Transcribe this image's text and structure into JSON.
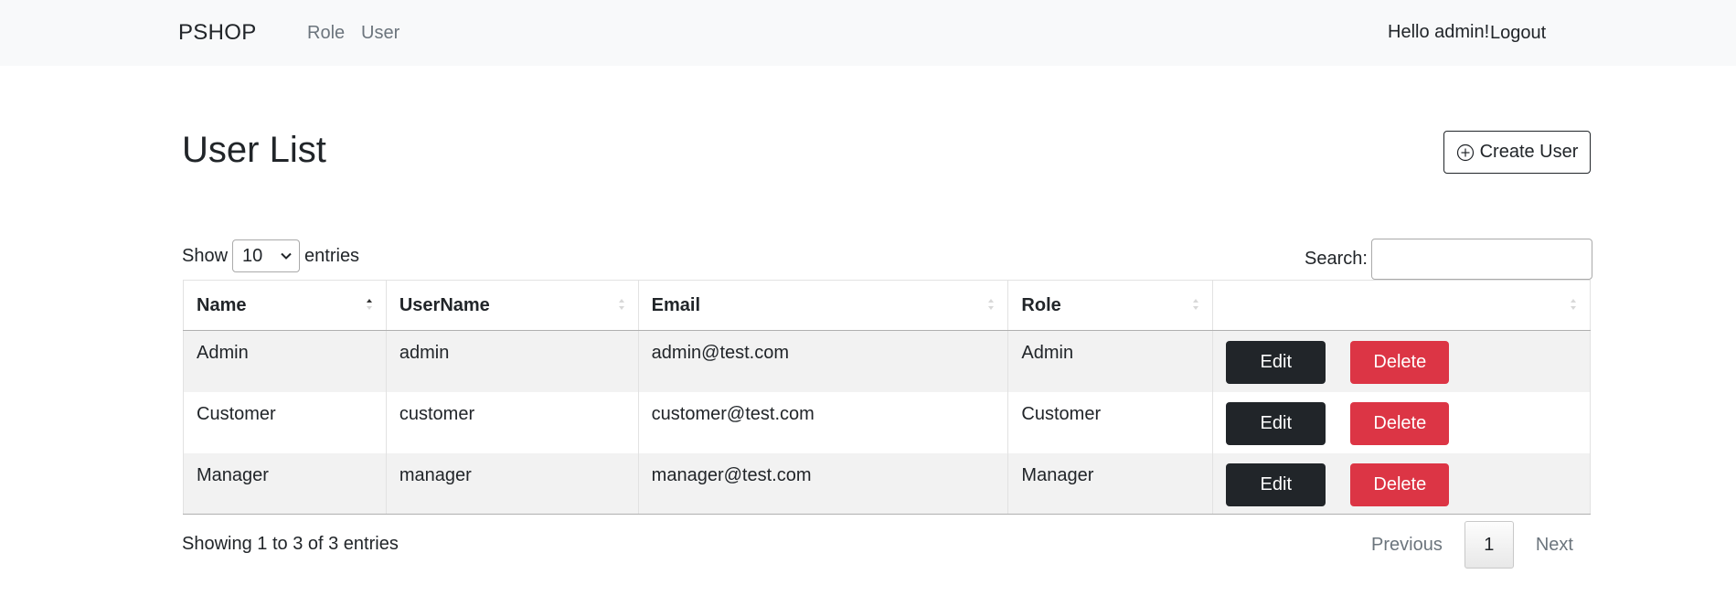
{
  "nav": {
    "brand": "PSHOP",
    "links": [
      "Role",
      "User"
    ],
    "greeting": "Hello admin!",
    "logout": "Logout"
  },
  "page": {
    "title": "User List",
    "create_label": "Create User"
  },
  "controls": {
    "show_label": "Show",
    "entries_value": "10",
    "entries_label": "entries",
    "search_label": "Search:",
    "search_value": ""
  },
  "table": {
    "columns": [
      "Name",
      "UserName",
      "Email",
      "Role",
      ""
    ],
    "rows": [
      {
        "name": "Admin",
        "username": "admin",
        "email": "admin@test.com",
        "role": "Admin"
      },
      {
        "name": "Customer",
        "username": "customer",
        "email": "customer@test.com",
        "role": "Customer"
      },
      {
        "name": "Manager",
        "username": "manager",
        "email": "manager@test.com",
        "role": "Manager"
      }
    ],
    "edit_label": "Edit",
    "delete_label": "Delete"
  },
  "footer": {
    "info": "Showing 1 to 3 of 3 entries",
    "previous": "Previous",
    "current_page": "1",
    "next": "Next"
  },
  "colors": {
    "navbar_bg": "#f8f9fa",
    "edit_btn": "#212529",
    "delete_btn": "#dc3545",
    "row_stripe": "#f2f2f2"
  }
}
